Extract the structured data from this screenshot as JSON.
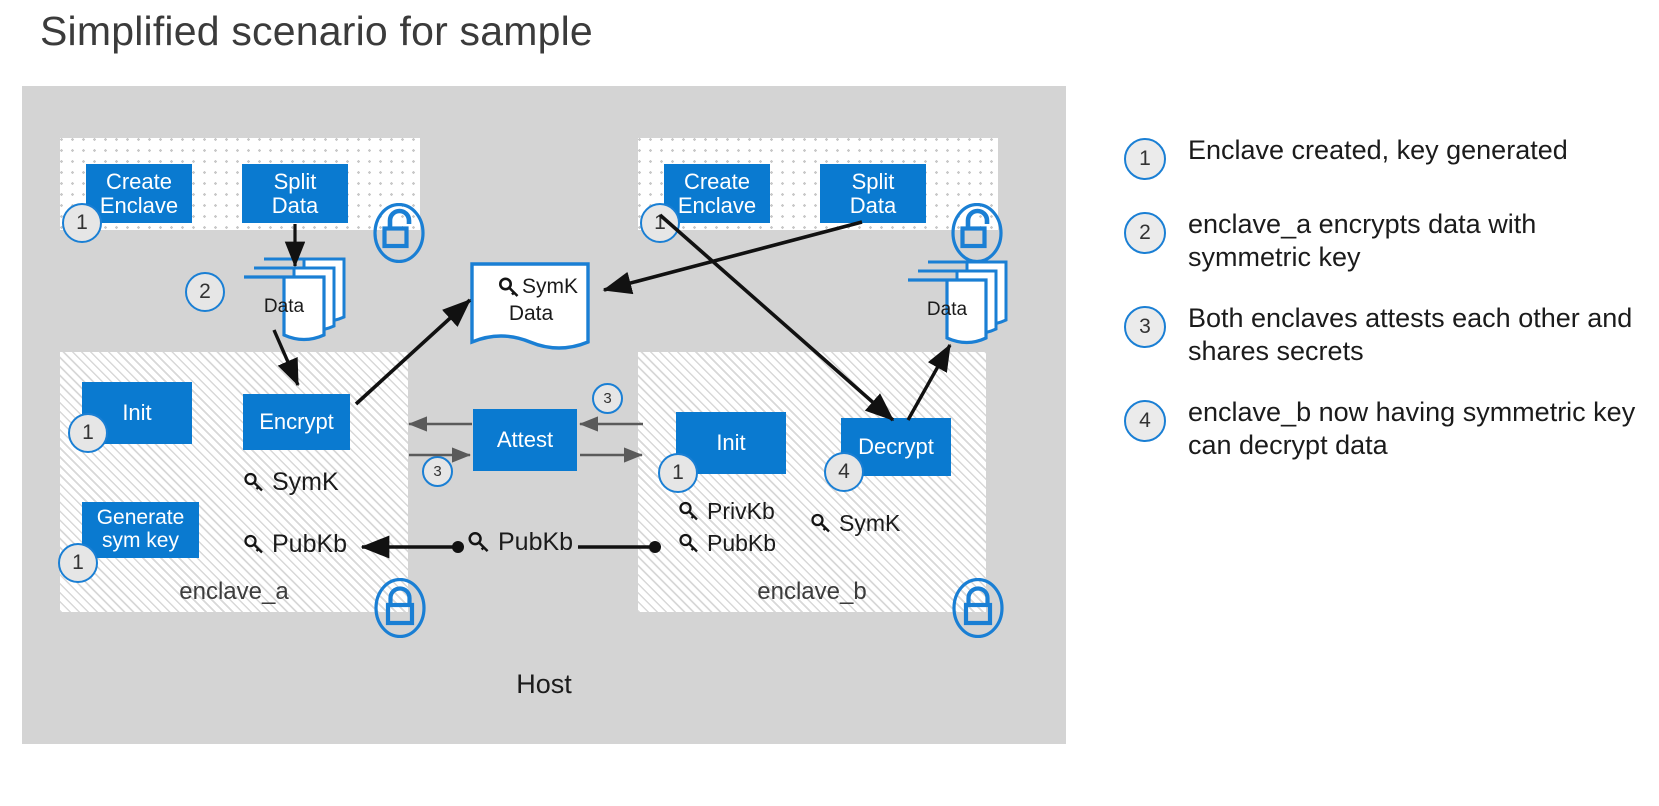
{
  "page": {
    "title": "Simplified scenario for sample"
  },
  "colors": {
    "accent_blue": "#0a7ad0",
    "outline_blue": "#1a7fd4",
    "host_gray": "#d4d4d4",
    "badge_gray": "#e6e6e6",
    "title_gray": "#3b3b3b"
  },
  "host": {
    "label": "Host"
  },
  "left": {
    "untrusted": {
      "boxes": [
        {
          "label": "Create\nEnclave",
          "line1": "Create",
          "line2": "Enclave"
        },
        {
          "label": "Split\nData",
          "line1": "Split",
          "line2": "Data"
        }
      ],
      "badge": "1",
      "lock": "unlocked-padlock-icon"
    },
    "data_doc": {
      "label": "Data",
      "badge": "2"
    },
    "enclave": {
      "name": "enclave_a",
      "boxes": [
        {
          "label": "Init",
          "badge": "1"
        },
        {
          "label": "Encrypt"
        },
        {
          "line1": "Generate",
          "line2": "sym key",
          "badge": "1"
        }
      ],
      "keys": [
        {
          "label": "SymK"
        },
        {
          "label": "PubKb"
        }
      ],
      "lock": "locked-padlock-icon"
    }
  },
  "middle": {
    "symk_doc": {
      "line1": "SymK",
      "line2": "Data",
      "key_icon": "key-icon"
    },
    "attest": {
      "label": "Attest",
      "badge_top": "3",
      "badge_bottom": "3"
    },
    "pubkb": {
      "label": "PubKb"
    }
  },
  "right": {
    "untrusted": {
      "boxes": [
        {
          "line1": "Create",
          "line2": "Enclave"
        },
        {
          "line1": "Split",
          "line2": "Data"
        }
      ],
      "badge": "1",
      "lock": "unlocked-padlock-icon"
    },
    "data_doc": {
      "label": "Data"
    },
    "enclave": {
      "name": "enclave_b",
      "boxes": [
        {
          "label": "Init",
          "badge": "1"
        },
        {
          "label": "Decrypt",
          "badge": "4"
        }
      ],
      "keys": [
        {
          "label": "PrivKb"
        },
        {
          "label": "PubKb"
        },
        {
          "label": "SymK"
        }
      ],
      "lock": "locked-padlock-icon"
    }
  },
  "legend": {
    "items": [
      {
        "num": "1",
        "text": "Enclave created, key generated"
      },
      {
        "num": "2",
        "text": "enclave_a encrypts data with symmetric key"
      },
      {
        "num": "3",
        "text": "Both enclaves attests each other and shares secrets"
      },
      {
        "num": "4",
        "text": "enclave_b now having symmetric key can decrypt data"
      }
    ]
  }
}
